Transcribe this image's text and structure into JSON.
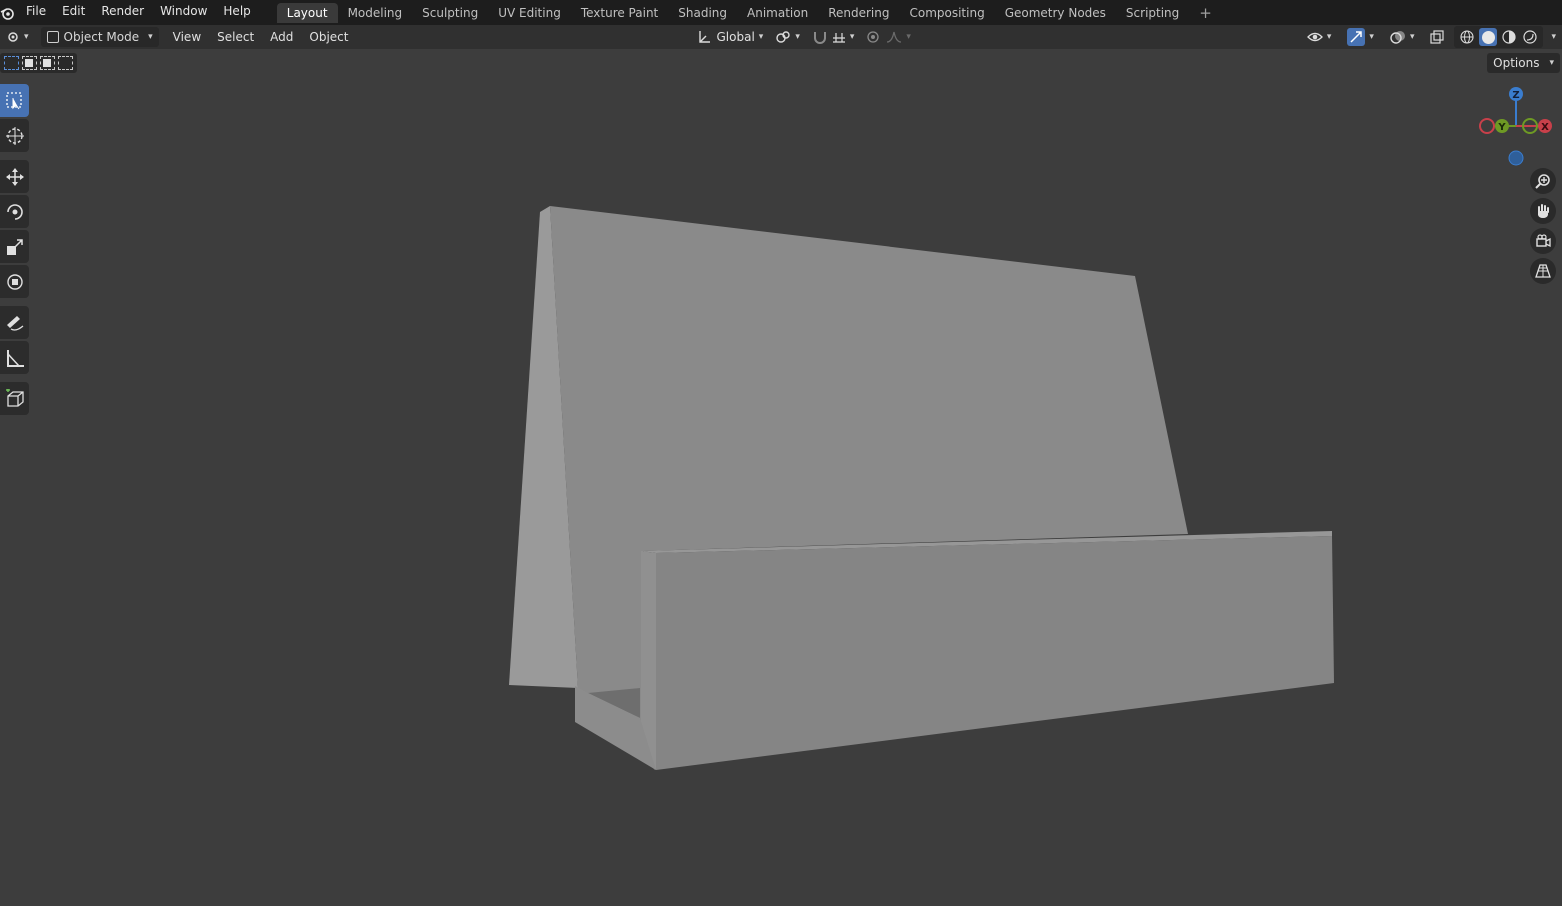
{
  "topbar": {
    "menus": [
      "File",
      "Edit",
      "Render",
      "Window",
      "Help"
    ],
    "workspaces": [
      "Layout",
      "Modeling",
      "Sculpting",
      "UV Editing",
      "Texture Paint",
      "Shading",
      "Animation",
      "Rendering",
      "Compositing",
      "Geometry Nodes",
      "Scripting"
    ],
    "active_workspace": "Layout",
    "add_tab": "+"
  },
  "header": {
    "mode": "Object Mode",
    "menus": [
      "View",
      "Select",
      "Add",
      "Object"
    ],
    "orientation": "Global"
  },
  "options_label": "Options",
  "gizmo": {
    "z": "Z",
    "y": "Y",
    "x": "X"
  },
  "colors": {
    "accent": "#4772b3",
    "axis_x": "#c8404a",
    "axis_y": "#6e9a24",
    "axis_z": "#3a7dcf",
    "viewport_bg": "#3d3d3d",
    "mesh": "#8a8a8a"
  },
  "toolbar_icons": [
    "select-box-icon",
    "cursor-icon",
    "move-icon",
    "rotate-icon",
    "scale-icon",
    "transform-icon",
    "annotate-icon",
    "measure-icon",
    "add-cube-icon"
  ],
  "nav_icons": [
    "zoom-icon",
    "pan-hand-icon",
    "camera-icon",
    "perspective-grid-icon"
  ]
}
